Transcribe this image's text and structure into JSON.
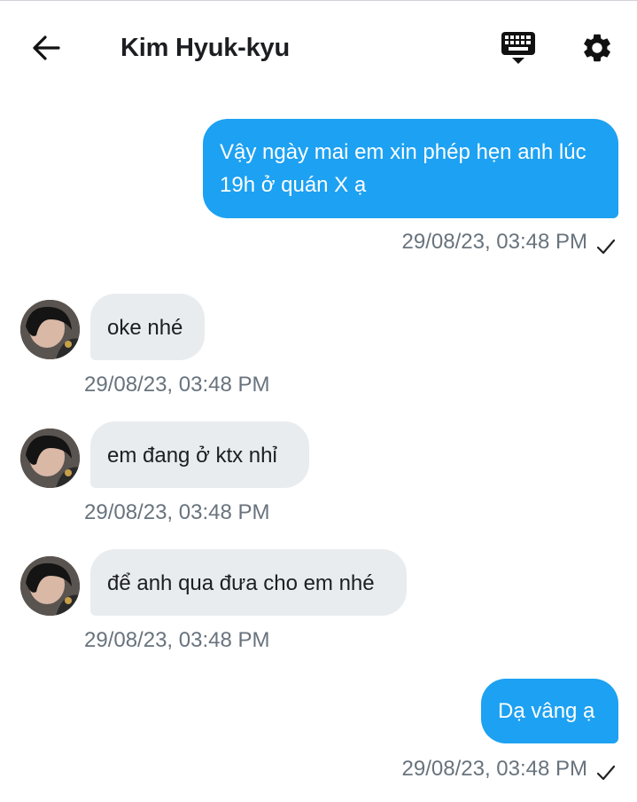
{
  "header": {
    "title": "Kim Hyuk-kyu",
    "back_icon": "arrow-left-icon",
    "keyboard_icon": "keyboard-icon",
    "settings_icon": "gear-icon"
  },
  "colors": {
    "outgoing_bubble": "#1da1f2",
    "incoming_bubble": "#e9ecef",
    "timestamp": "#68737d"
  },
  "messages": [
    {
      "direction": "out",
      "text": "Vậy ngày mai em xin phép hẹn anh lúc 19h ở quán X ạ",
      "timestamp": "29/08/23, 03:48 PM",
      "status": "sent-check-icon"
    },
    {
      "direction": "in",
      "text": "oke nhé",
      "timestamp": "29/08/23, 03:48 PM"
    },
    {
      "direction": "in",
      "text": "em đang ở ktx nhỉ",
      "timestamp": "29/08/23, 03:48 PM"
    },
    {
      "direction": "in",
      "text": "để anh qua đưa cho em nhé",
      "timestamp": "29/08/23, 03:48 PM"
    },
    {
      "direction": "out",
      "text": "Dạ vâng ạ",
      "timestamp": "29/08/23, 03:48 PM",
      "status": "sent-check-icon"
    }
  ]
}
